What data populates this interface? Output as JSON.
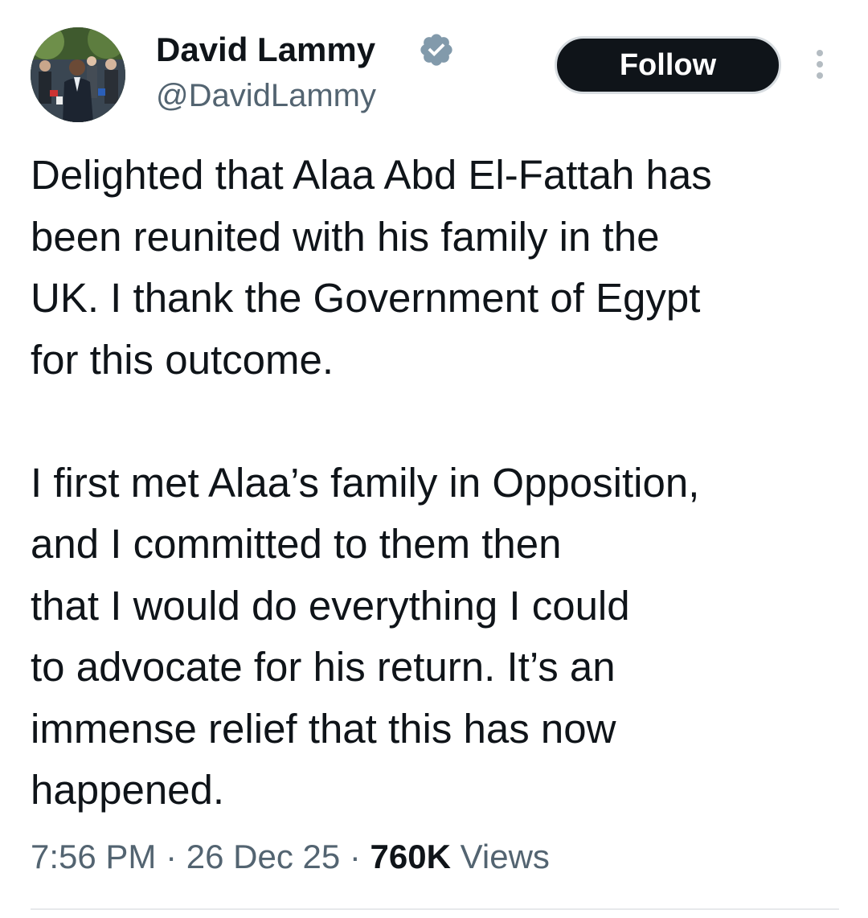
{
  "author": {
    "display_name": "David Lammy",
    "handle": "@DavidLammy",
    "verified": true,
    "avatar_icon": "profile-photo"
  },
  "actions": {
    "follow_label": "Follow",
    "more_icon": "more-vertical-icon"
  },
  "tweet": {
    "paragraphs": [
      "Delighted that Alaa Abd El-Fattah has\nbeen reunited with his family in the\nUK. I thank the Government of Egypt\nfor this outcome.",
      "I first met Alaa’s family in Opposition,\nand I committed to them then\nthat I would do everything I could\nto advocate for his return. It’s an\nimmense relief that this has now\nhappened."
    ]
  },
  "meta": {
    "time": "7:56 PM",
    "separator": " · ",
    "date": "26 Dec 25",
    "views_count": "760K",
    "views_label": " Views"
  },
  "colors": {
    "text": "#0f1419",
    "secondary": "#536471",
    "verified_badge": "#829aab",
    "button": "#0f1419"
  }
}
